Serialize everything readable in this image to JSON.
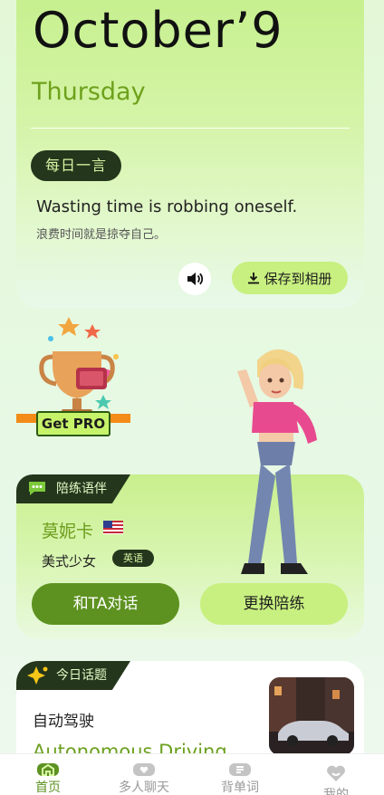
{
  "header": {
    "date": "October’9",
    "weekday": "Thursday"
  },
  "quote": {
    "badge": "每日一言",
    "english": "Wasting time is robbing oneself.",
    "chinese": "浪费时间就是掠夺自己。",
    "save_label": "保存到相册"
  },
  "promo": {
    "label": "Get PRO"
  },
  "tutor": {
    "section_label": "陪练语伴",
    "name": "莫妮卡",
    "description": "美式少女",
    "language": "英语",
    "chat_button": "和TA对话",
    "switch_button": "更换陪练"
  },
  "topic": {
    "section_label": "今日话题",
    "chinese": "自动驾驶",
    "english": "Autonomous Driving"
  },
  "tabs": [
    {
      "label": "首页",
      "icon": "home-icon",
      "active": true
    },
    {
      "label": "多人聊天",
      "icon": "cards-icon",
      "active": false
    },
    {
      "label": "背单词",
      "icon": "book-icon",
      "active": false
    },
    {
      "label": "我的",
      "icon": "heart-icon",
      "active": false
    }
  ],
  "colors": {
    "accent": "#5d9220",
    "accent_light": "#c8f080",
    "dark_badge": "#24361c"
  }
}
